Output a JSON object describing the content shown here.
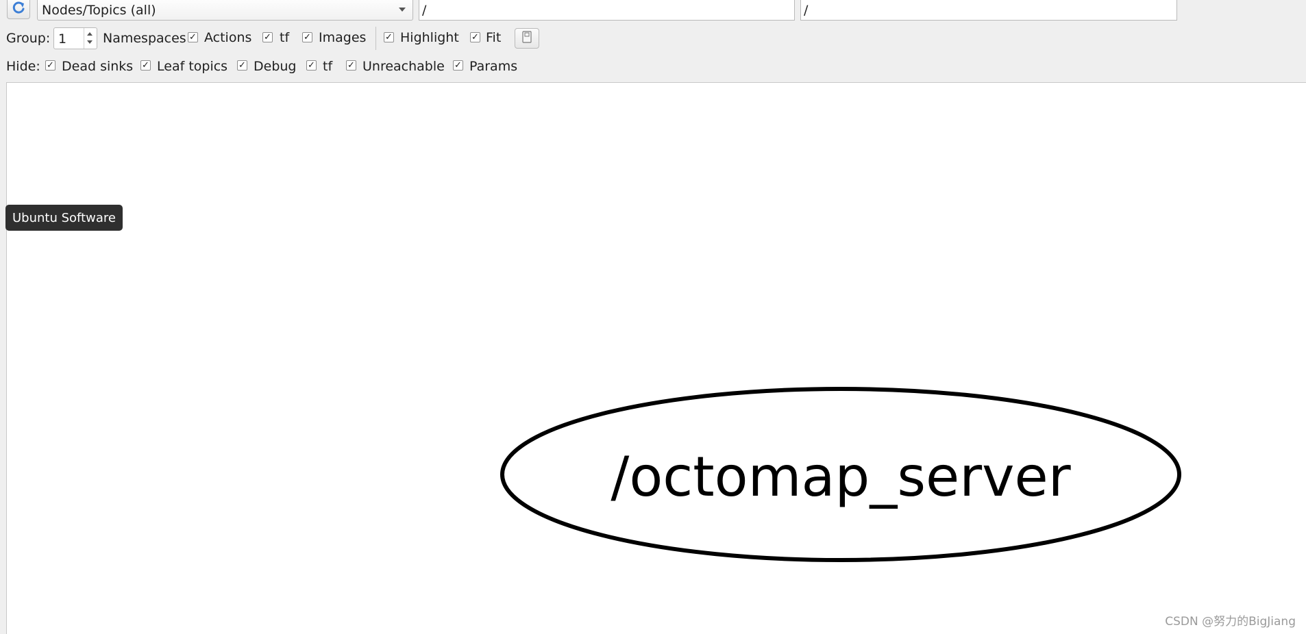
{
  "toolbar": {
    "refresh_icon": "refresh-icon",
    "graph_type": {
      "selected": "Nodes/Topics (all)"
    },
    "namespace_filter": "/",
    "topic_filter": "/"
  },
  "options": {
    "group_label": "Group:",
    "group_value": "1",
    "namespaces_label": "Namespaces",
    "namespaces_checked": true,
    "actions_label": "Actions",
    "actions_checked": true,
    "tf_label": "tf",
    "tf_checked": true,
    "images_label": "Images",
    "images_checked": true,
    "highlight_label": "Highlight",
    "highlight_checked": true,
    "fit_label": "Fit",
    "fit_checked": true,
    "save_icon": "save-image-icon"
  },
  "hide": {
    "label": "Hide:",
    "items": [
      {
        "label": "Dead sinks",
        "checked": true
      },
      {
        "label": "Leaf topics",
        "checked": true
      },
      {
        "label": "Debug",
        "checked": true
      },
      {
        "label": "tf",
        "checked": true
      },
      {
        "label": "Unreachable",
        "checked": true
      },
      {
        "label": "Params",
        "checked": true
      }
    ]
  },
  "graph": {
    "nodes": [
      {
        "label": "/octomap_server"
      }
    ]
  },
  "tooltip": "Ubuntu Software",
  "watermark": "CSDN @努力的BigJiang",
  "colors": {
    "background": "#efefef",
    "canvas": "#ffffff",
    "tooltip_bg": "#2f2f2f",
    "refresh_icon": "#3d7fd6"
  }
}
